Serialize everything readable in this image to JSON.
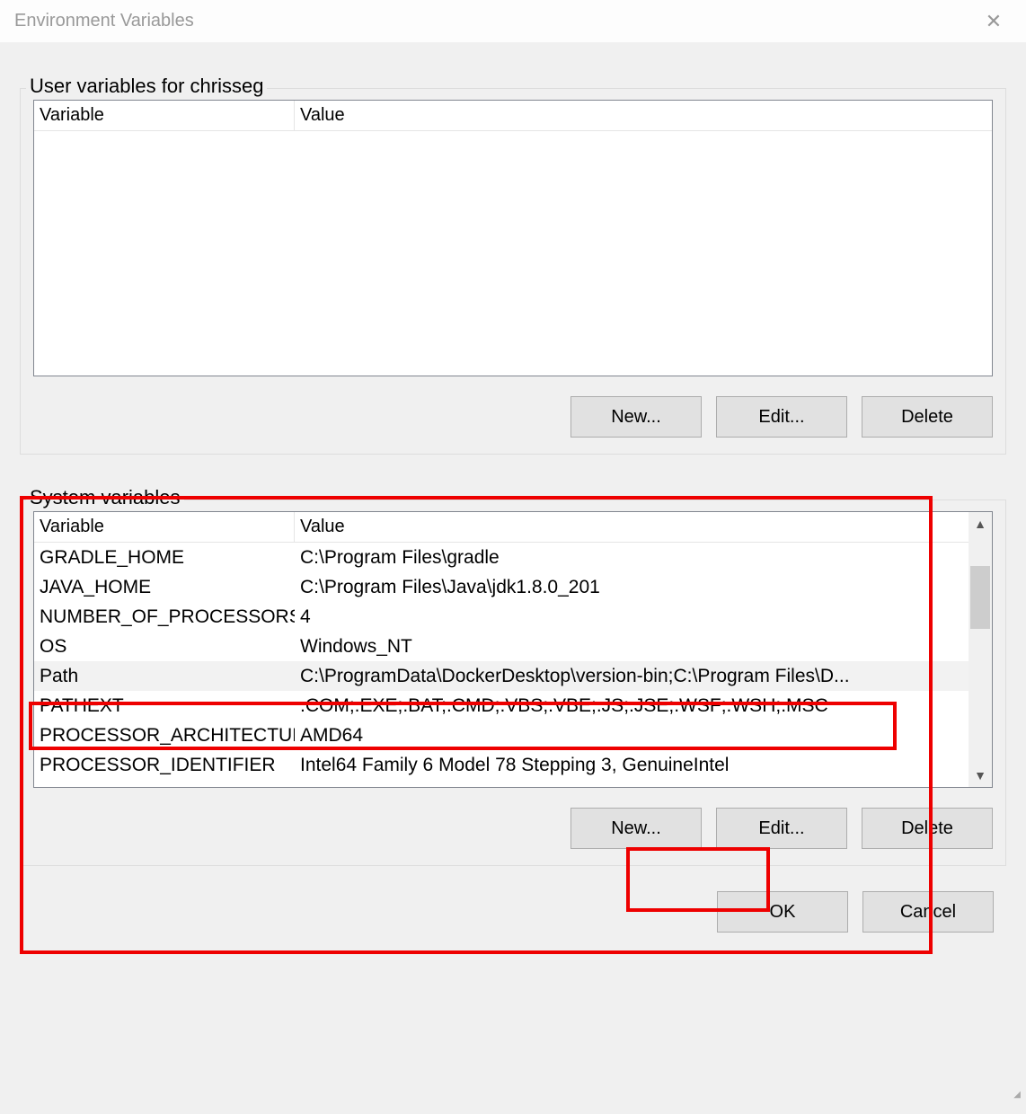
{
  "titlebar": {
    "title": "Environment Variables"
  },
  "userVars": {
    "legend": "User variables for chrisseg",
    "columns": {
      "variable": "Variable",
      "value": "Value"
    },
    "rows": [],
    "buttons": {
      "new": "New...",
      "edit": "Edit...",
      "delete": "Delete"
    }
  },
  "sysVars": {
    "legend": "System variables",
    "columns": {
      "variable": "Variable",
      "value": "Value"
    },
    "rows": [
      {
        "variable": "GRADLE_HOME",
        "value": "C:\\Program Files\\gradle",
        "selected": false
      },
      {
        "variable": "JAVA_HOME",
        "value": "C:\\Program Files\\Java\\jdk1.8.0_201",
        "selected": false
      },
      {
        "variable": "NUMBER_OF_PROCESSORS",
        "value": "4",
        "selected": false
      },
      {
        "variable": "OS",
        "value": "Windows_NT",
        "selected": false
      },
      {
        "variable": "Path",
        "value": "C:\\ProgramData\\DockerDesktop\\version-bin;C:\\Program Files\\D...",
        "selected": true
      },
      {
        "variable": "PATHEXT",
        "value": ".COM;.EXE;.BAT;.CMD;.VBS;.VBE;.JS;.JSE;.WSF;.WSH;.MSC",
        "selected": false
      },
      {
        "variable": "PROCESSOR_ARCHITECTURE",
        "value": "AMD64",
        "selected": false
      },
      {
        "variable": "PROCESSOR_IDENTIFIER",
        "value": "Intel64 Family 6 Model 78 Stepping 3, GenuineIntel",
        "selected": false
      }
    ],
    "buttons": {
      "new": "New...",
      "edit": "Edit...",
      "delete": "Delete"
    }
  },
  "bottom": {
    "ok": "OK",
    "cancel": "Cancel"
  }
}
